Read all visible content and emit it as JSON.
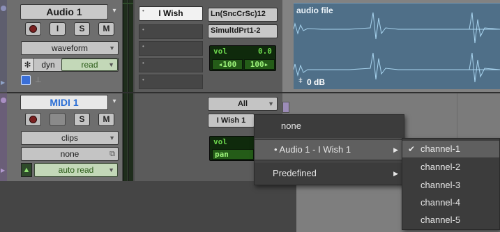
{
  "audio_track": {
    "name": "Audio 1",
    "solo_label": "S",
    "mute_label": "M",
    "input_label": "I",
    "view_selector": "waveform",
    "automation_label": "dyn",
    "automation_mode": "read",
    "insert_name": "I Wish",
    "input_path": "Ln(SncCrSc)12",
    "output_path": "SimultdPrt1-2",
    "vol_label": "vol",
    "vol_value": "0.0",
    "pan_left": "◂100",
    "pan_right": "100▸"
  },
  "midi_track": {
    "name": "MIDI 1",
    "solo_label": "S",
    "mute_label": "M",
    "view_selector": "clips",
    "patch_selector": "none",
    "automation_mode": "auto read",
    "input_selector": "All",
    "output_selector": "I Wish 1",
    "vol_label": "vol",
    "pan_label": "pan"
  },
  "clip": {
    "name": "audio file",
    "gain": "0 dB"
  },
  "context_menu": {
    "items": [
      {
        "label": "none"
      },
      {
        "label": "• Audio 1 - I Wish 1",
        "has_submenu": true
      },
      {
        "label": "Predefined",
        "has_submenu": true
      }
    ]
  },
  "submenu": {
    "items": [
      {
        "label": "channel-1",
        "checked": true
      },
      {
        "label": "channel-2"
      },
      {
        "label": "channel-3"
      },
      {
        "label": "channel-4"
      },
      {
        "label": "channel-5"
      }
    ]
  },
  "colors": {
    "accent_midi_name": "#2c6fd6",
    "lcd_green": "#6dd84d",
    "waveform": "#a8d4ef"
  }
}
